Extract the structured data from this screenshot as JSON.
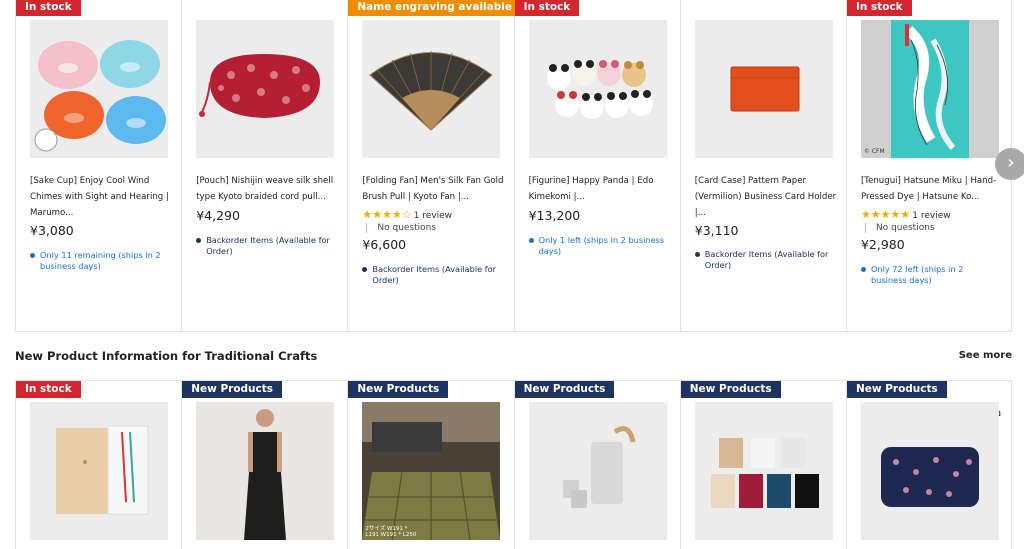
{
  "row1": [
    {
      "badge": "In stock",
      "badge_color": "red",
      "title": "[Sake Cup] Enjoy Cool Wind Chimes with Sight and Hearing | Marumo...",
      "price": "¥3,080",
      "stock": "Only 11 remaining (ships in 2 business days)",
      "stock_color": "blue",
      "image": "sake-cups"
    },
    {
      "badge": "",
      "badge_color": "",
      "title": "[Pouch] Nishijin weave silk shell type Kyoto braided cord pull...",
      "price": "¥4,290",
      "stock": "Backorder Items (Available for Order)",
      "stock_color": "navy",
      "image": "pouch"
    },
    {
      "badge": "Name engraving available",
      "badge_color": "orange",
      "title": "[Folding Fan] Men's Silk Fan Gold Brush Pull | Kyoto Fan |...",
      "stars": "★★★★☆",
      "reviews": "1 review",
      "questions": "No questions",
      "price": "¥6,600",
      "stock": "Backorder Items (Available for Order)",
      "stock_color": "navy",
      "image": "fan"
    },
    {
      "badge": "In stock",
      "badge_color": "red",
      "title": "[Figurine] Happy Panda | Edo Kimekomi |...",
      "price": "¥13,200",
      "stock": "Only 1 left (ships in 2 business days)",
      "stock_color": "blue",
      "image": "pandas"
    },
    {
      "badge": "",
      "badge_color": "",
      "title": "[Card Case] Pattern Paper (Vermilion) Business Card Holder |...",
      "price": "¥3,110",
      "stock": "Backorder Items (Available for Order)",
      "stock_color": "navy",
      "image": "card-case"
    },
    {
      "badge": "In stock",
      "badge_color": "red",
      "title": "[Tenugui] Hatsune Miku | Hand-Pressed Dye | Hatsune Ko...",
      "stars": "★★★★★",
      "reviews": "1 review",
      "questions": "No questions",
      "price": "¥2,980",
      "stock": "Only 72 left (ships in 2 business days)",
      "stock_color": "blue",
      "image": "tenugui",
      "image_caption": "© CFM"
    }
  ],
  "section": {
    "title": "New Product Information for Traditional Crafts",
    "see_more": "See more"
  },
  "row2": [
    {
      "badge": "In stock",
      "badge_color": "red",
      "image": "chopsticks-box"
    },
    {
      "badge": "New Products",
      "badge_color": "navy",
      "image": "dress"
    },
    {
      "badge": "New Products",
      "badge_color": "navy",
      "image": "rug",
      "image_caption": "2サイズ W191 * L191 W191 * L250"
    },
    {
      "badge": "New Products",
      "badge_color": "navy",
      "image": "sake-set"
    },
    {
      "badge": "New Products",
      "badge_color": "navy",
      "image": "paper-cards"
    },
    {
      "badge": "New Products",
      "badge_color": "navy",
      "image": "wallet"
    }
  ],
  "nav": {
    "next_icon": "chevron-right-icon",
    "glyph": "›"
  }
}
